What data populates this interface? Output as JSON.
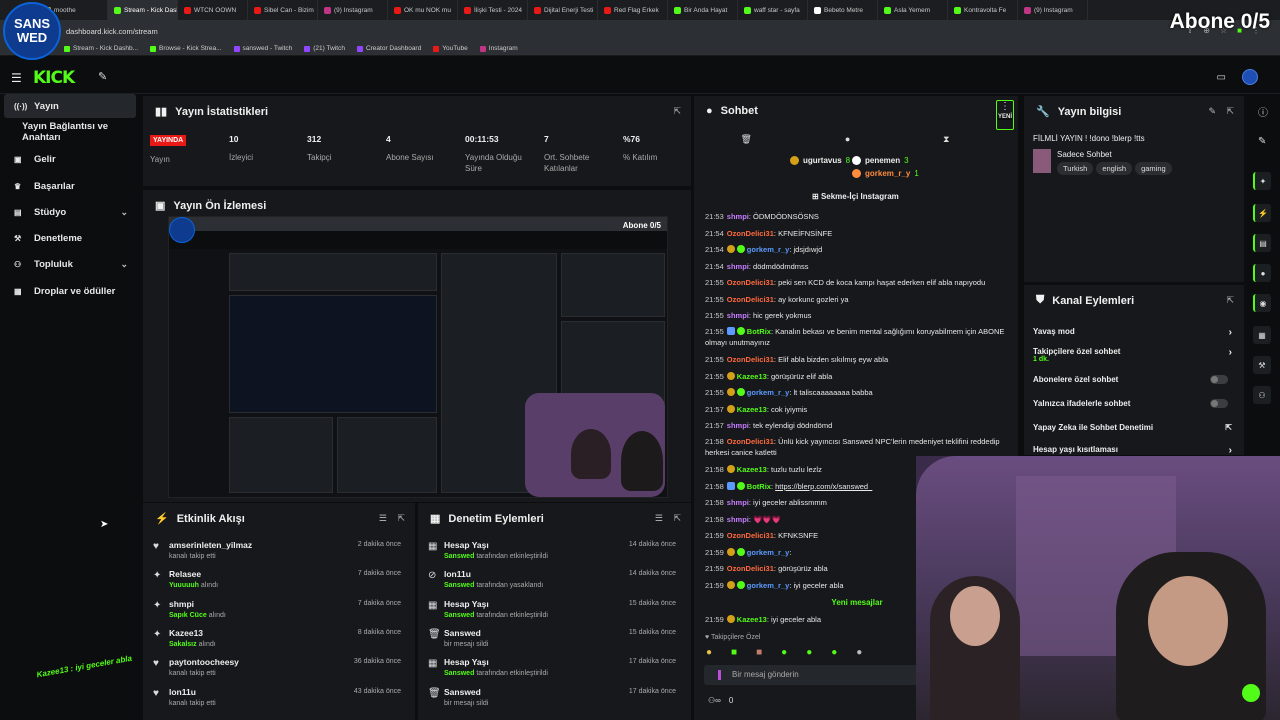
{
  "browser": {
    "tabs": [
      "moothe",
      "Stream - Kick Dashb",
      "WTCN OOWN",
      "Sibel Can - Bizim",
      "(9) Instagram",
      "OK mu NOK mu",
      "İlişki Testi - 2024",
      "Dijital Enerji Testi",
      "Red Flag Erkek",
      "Bir Anda Hayat",
      "waff star - sayfa",
      "Bebeto Metre",
      "Asla Yemem",
      "Kontravolta Fe",
      "(9) Instagram"
    ],
    "url": "dashboard.kick.com/stream",
    "bookmarks": [
      "Stream - Kick Dashb...",
      "Browse - Kick Strea...",
      "sanswed - Twitch",
      "(21) Twitch",
      "Creator Dashboard",
      "YouTube",
      "Instagram"
    ]
  },
  "overlay": {
    "logo_line1": "SANS",
    "logo_line2": "WED",
    "abone": "Abone 0/5",
    "bottom_chat": "Kazee13 : iyi geceler abla"
  },
  "sidebar": {
    "items": [
      {
        "label": "Yayın",
        "icon": "stream-icon"
      },
      {
        "label": "Yayın Bağlantısı ve Anahtarı",
        "icon": ""
      },
      {
        "label": "Gelir",
        "icon": "money-icon"
      },
      {
        "label": "Başarılar",
        "icon": "trophy-icon"
      },
      {
        "label": "Stüdyo",
        "icon": "studio-icon"
      },
      {
        "label": "Denetleme",
        "icon": "hammer-icon"
      },
      {
        "label": "Topluluk",
        "icon": "community-icon"
      },
      {
        "label": "Droplar ve ödüller",
        "icon": "drops-icon"
      }
    ]
  },
  "stats": {
    "title": "Yayın İstatistikleri",
    "live": "YAYINDA",
    "live_label": "Yayın",
    "items": [
      {
        "value": "10",
        "label": "İzleyici"
      },
      {
        "value": "312",
        "label": "Takipçi"
      },
      {
        "value": "4",
        "label": "Abone Sayısı"
      },
      {
        "value": "00:11:53",
        "label": "Yayında Olduğu Süre"
      },
      {
        "value": "7",
        "label": "Ort. Sohbete Katılanlar"
      },
      {
        "value": "%76",
        "label": "% Katılım"
      }
    ]
  },
  "preview": {
    "title": "Yayın Ön İzlemesi",
    "abone": "Abone 0/5"
  },
  "activity": {
    "title": "Etkinlik Akışı",
    "items": [
      {
        "name": "amserinleten_yilmaz",
        "sub_hl": "",
        "sub": "kanalı takip etti",
        "time": "2 dakika önce",
        "icon": "♥"
      },
      {
        "name": "Relasee",
        "sub_hl": "Yuuuuuh",
        "sub": "alındı",
        "time": "7 dakika önce",
        "icon": "✦"
      },
      {
        "name": "shmpi",
        "sub_hl": "Sapık Cüce",
        "sub": "alındı",
        "time": "7 dakika önce",
        "icon": "✦"
      },
      {
        "name": "Kazee13",
        "sub_hl": "Sakalsız",
        "sub": "alındı",
        "time": "8 dakika önce",
        "icon": "✦"
      },
      {
        "name": "paytontoocheesy",
        "sub_hl": "",
        "sub": "kanalı takip etti",
        "time": "36 dakika önce",
        "icon": "♥"
      },
      {
        "name": "lon11u",
        "sub_hl": "",
        "sub": "kanalı takip etti",
        "time": "43 dakika önce",
        "icon": "♥"
      }
    ]
  },
  "moderation": {
    "title": "Denetim Eylemleri",
    "items": [
      {
        "name": "Hesap Yaşı",
        "sub_hl": "Sanswed",
        "sub": "tarafından etkinleştirildi",
        "time": "14 dakika önce",
        "icon": "▦"
      },
      {
        "name": "lon11u",
        "sub_hl": "Sanswed",
        "sub": "tarafından yasaklandı",
        "time": "14 dakika önce",
        "icon": "⊘"
      },
      {
        "name": "Hesap Yaşı",
        "sub_hl": "Sanswed",
        "sub": "tarafından etkinleştirildi",
        "time": "15 dakika önce",
        "icon": "▦"
      },
      {
        "name": "Sanswed",
        "sub_hl": "",
        "sub": "bir mesajı sildi",
        "time": "15 dakika önce",
        "icon": "🗑"
      },
      {
        "name": "Hesap Yaşı",
        "sub_hl": "Sanswed",
        "sub": "tarafından etkinleştirildi",
        "time": "17 dakika önce",
        "icon": "▦"
      },
      {
        "name": "Sanswed",
        "sub_hl": "",
        "sub": "bir mesajı sildi",
        "time": "17 dakika önce",
        "icon": "🗑"
      }
    ]
  },
  "chat": {
    "title": "Sohbet",
    "yeni": "YENİ",
    "top_users": [
      {
        "name": "ugurtavus",
        "count": "8"
      },
      {
        "name": "penemen",
        "count": "3"
      },
      {
        "name": "gorkem_r_y",
        "count": "1"
      }
    ],
    "pinned": "Sekme-İçi Instagram",
    "messages": [
      {
        "time": "21:53",
        "user": "shmpi",
        "color": "#c77dff",
        "text": "ÖDMDÖDNSÖSNS",
        "badge": ""
      },
      {
        "time": "21:54",
        "user": "OzonDelici31",
        "color": "#ff6a3d",
        "text": "KFNEİFNSİNFE",
        "badge": ""
      },
      {
        "time": "21:54",
        "user": "gorkem_r_y",
        "color": "#5b9bff",
        "text": "jdsjdıwjd",
        "badge": "gold-green"
      },
      {
        "time": "21:54",
        "user": "shmpi",
        "color": "#c77dff",
        "text": "dödmdödmdmss",
        "badge": ""
      },
      {
        "time": "21:55",
        "user": "OzonDelici31",
        "color": "#ff6a3d",
        "text": "peki sen KCD de koca kampı haşat ederken elif abla napıyodu",
        "badge": ""
      },
      {
        "time": "21:55",
        "user": "OzonDelici31",
        "color": "#ff6a3d",
        "text": "ay korkunc gozleri ya",
        "badge": ""
      },
      {
        "time": "21:55",
        "user": "shmpi",
        "color": "#c77dff",
        "text": "hic gerek yokmus",
        "badge": ""
      },
      {
        "time": "21:55",
        "user": "BotRix",
        "color": "#53fc18",
        "text": "Kanalın bekası ve benim mental sağlığımı koruyabilmem için ABONE olmayı unutmayınız",
        "badge": "bot"
      },
      {
        "time": "21:55",
        "user": "OzonDelici31",
        "color": "#ff6a3d",
        "text": "Elif abla bizden sıkılmış eyw abla",
        "badge": ""
      },
      {
        "time": "21:55",
        "user": "Kazee13",
        "color": "#53fc18",
        "text": "görüşürüz elif abla",
        "badge": "gold"
      },
      {
        "time": "21:55",
        "user": "gorkem_r_y",
        "color": "#5b9bff",
        "text": "lt taliscaaaaaaaa babba",
        "badge": "gold-green"
      },
      {
        "time": "21:57",
        "user": "Kazee13",
        "color": "#53fc18",
        "text": "cok iyiymis",
        "badge": "gold"
      },
      {
        "time": "21:57",
        "user": "shmpi",
        "color": "#c77dff",
        "text": "tek eylendigi dödndömd",
        "badge": ""
      },
      {
        "time": "21:58",
        "user": "OzonDelici31",
        "color": "#ff6a3d",
        "text": "Ünlü kick yayıncısı Sanswed NPC'lerin medeniyet teklifini reddedip herkesi canice katletti",
        "badge": ""
      },
      {
        "time": "21:58",
        "user": "Kazee13",
        "color": "#53fc18",
        "text": "tuzlu tuzlu lezlz",
        "badge": "gold"
      },
      {
        "time": "21:58",
        "user": "BotRix",
        "color": "#53fc18",
        "text": "https://blerp.com/x/sanswed_",
        "badge": "bot"
      },
      {
        "time": "21:58",
        "user": "shmpi",
        "color": "#c77dff",
        "text": "iyi geceler ablissmmm",
        "badge": ""
      },
      {
        "time": "21:58",
        "user": "shmpi",
        "color": "#c77dff",
        "text": "💗💗💗",
        "badge": ""
      },
      {
        "time": "21:59",
        "user": "OzonDelici31",
        "color": "#ff6a3d",
        "text": "KFNKSNFE",
        "badge": ""
      },
      {
        "time": "21:59",
        "user": "gorkem_r_y",
        "color": "#5b9bff",
        "text": "",
        "badge": "gold-green"
      },
      {
        "time": "21:59",
        "user": "OzonDelici31",
        "color": "#ff6a3d",
        "text": "görüşürüz abla",
        "badge": ""
      },
      {
        "time": "21:59",
        "user": "gorkem_r_y",
        "color": "#5b9bff",
        "text": "iyi geceler abla",
        "badge": "gold-green"
      }
    ],
    "new_messages": "Yeni mesajlar",
    "last": {
      "time": "21:59",
      "user": "Kazee13",
      "text": "iyi geceler abla"
    },
    "followers_only": "Takipçilere Özel",
    "input_placeholder": "Bir mesaj gönderin",
    "footer_count": "0"
  },
  "stream_info": {
    "title": "Yayın bilgisi",
    "stream_title": "FİLMLİ YAYIN ! !dono !blerp !tts",
    "category": "Sadece Sohbet",
    "tags": [
      "Turkish",
      "english",
      "gaming"
    ]
  },
  "channel_actions": {
    "title": "Kanal Eylemleri",
    "items": [
      {
        "label": "Yavaş mod",
        "sub": "",
        "control": "arrow"
      },
      {
        "label": "Takipçilere özel sohbet",
        "sub": "1 dk.",
        "control": "arrow"
      },
      {
        "label": "Abonelere özel sohbet",
        "sub": "",
        "control": "toggle"
      },
      {
        "label": "Yalnızca ifadelerle sohbet",
        "sub": "",
        "control": "toggle"
      },
      {
        "label": "Yapay Zeka ile Sohbet Denetimi",
        "sub": "",
        "control": "external"
      },
      {
        "label": "Hesap yaşı kısıtlaması",
        "sub": "",
        "control": "arrow"
      }
    ]
  },
  "colors": {
    "accent": "#53fc18",
    "live": "#e91916",
    "panel": "#16181b",
    "bg": "#0b0d0e"
  }
}
